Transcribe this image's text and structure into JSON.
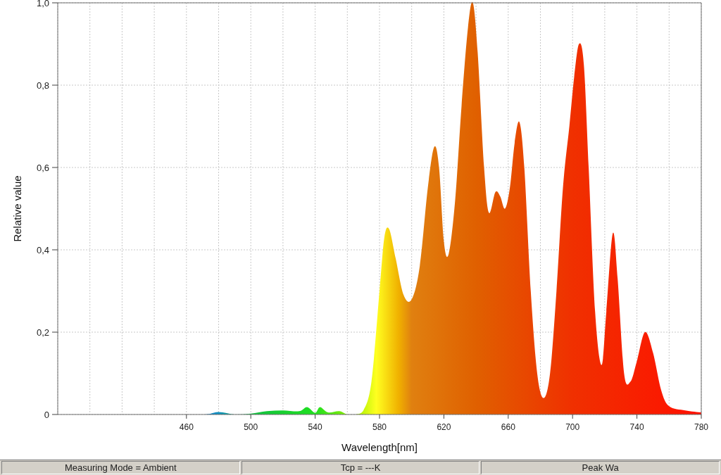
{
  "chart": {
    "chart_data": {
      "type": "area",
      "xlabel": "Wavelength[nm]",
      "ylabel": "Relative value",
      "xlim": [
        380,
        780
      ],
      "ylim": [
        0,
        1
      ],
      "xticks": [
        460,
        500,
        540,
        580,
        620,
        660,
        700,
        740,
        780
      ],
      "yticks": [
        {
          "value": 0,
          "label": "0"
        },
        {
          "value": 0.2,
          "label": "0,2"
        },
        {
          "value": 0.4,
          "label": "0,4"
        },
        {
          "value": 0.6,
          "label": "0,6"
        },
        {
          "value": 0.8,
          "label": "0,8"
        },
        {
          "value": 1,
          "label": "1,0"
        }
      ],
      "x": [
        380,
        440,
        470,
        480,
        490,
        500,
        510,
        520,
        530,
        535,
        540,
        543,
        548,
        555,
        560,
        565,
        570,
        575,
        580,
        583,
        586,
        590,
        595,
        600,
        605,
        610,
        614,
        617,
        620,
        623,
        627,
        631,
        635,
        638,
        641,
        645,
        648,
        652,
        655,
        658,
        661,
        664,
        667,
        670,
        674,
        678,
        682,
        686,
        690,
        694,
        698,
        701,
        704,
        707,
        710,
        714,
        718,
        721,
        725,
        728,
        732,
        736,
        740,
        745,
        750,
        755,
        760,
        770,
        780
      ],
      "grid": true,
      "series": [
        {
          "values": [
            0,
            0,
            0,
            0.006,
            0,
            0.002,
            0.008,
            0.01,
            0.008,
            0.018,
            0.004,
            0.018,
            0.005,
            0.008,
            0,
            0,
            0.01,
            0.08,
            0.3,
            0.43,
            0.45,
            0.38,
            0.29,
            0.28,
            0.36,
            0.55,
            0.65,
            0.6,
            0.42,
            0.39,
            0.52,
            0.75,
            0.94,
            1.0,
            0.88,
            0.6,
            0.49,
            0.54,
            0.53,
            0.5,
            0.55,
            0.66,
            0.71,
            0.6,
            0.3,
            0.1,
            0.04,
            0.1,
            0.3,
            0.55,
            0.7,
            0.82,
            0.9,
            0.85,
            0.6,
            0.25,
            0.12,
            0.25,
            0.44,
            0.33,
            0.1,
            0.08,
            0.13,
            0.2,
            0.15,
            0.06,
            0.02,
            0.01,
            0.005
          ]
        }
      ]
    }
  },
  "status_bar": [
    "Measuring Mode = Ambient",
    "Tcp = ---K",
    "Peak Wa"
  ]
}
